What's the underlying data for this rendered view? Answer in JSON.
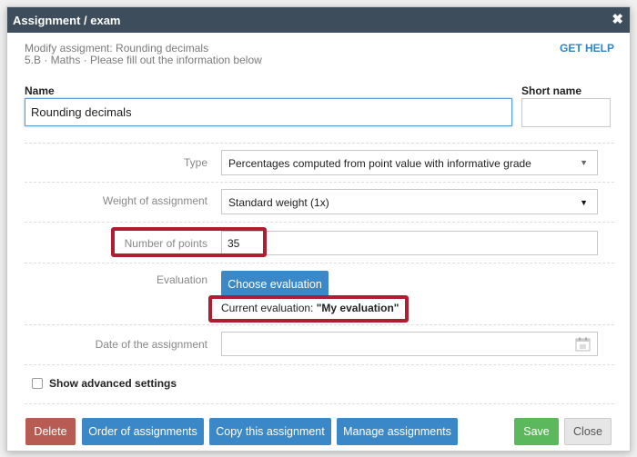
{
  "dialog": {
    "title": "Assignment / exam",
    "close_glyph": "✖",
    "subtitle_line1": "Modify assigment: Rounding decimals",
    "subtitle_line2": "5.B · Maths · Please fill out the information below",
    "help_link": "GET HELP"
  },
  "name_field": {
    "label": "Name",
    "value": "Rounding decimals"
  },
  "short_name_field": {
    "label": "Short name",
    "value": ""
  },
  "type_field": {
    "label": "Type",
    "value": "Percentages computed from point value with informative grade"
  },
  "weight_field": {
    "label": "Weight of assignment",
    "value": "Standard weight (1x)"
  },
  "points_field": {
    "label": "Number of points",
    "value": "35"
  },
  "evaluation": {
    "label": "Evaluation",
    "choose_button": "Choose evaluation",
    "current_prefix": "Current evaluation:",
    "current_value": "\"My evaluation\""
  },
  "date_field": {
    "label": "Date of the assignment",
    "value": "",
    "icon": "calendar-icon"
  },
  "advanced": {
    "label": "Show advanced settings",
    "checked": false
  },
  "footer": {
    "delete": "Delete",
    "order": "Order of assignments",
    "copy": "Copy this assignment",
    "manage": "Manage assignments",
    "save": "Save",
    "close": "Close"
  },
  "colors": {
    "titlebar": "#3d4d5c",
    "accent_blue": "#3b88c8",
    "delete_red": "#b85c53",
    "save_green": "#5cb85c",
    "highlight_red": "#b01d30"
  }
}
